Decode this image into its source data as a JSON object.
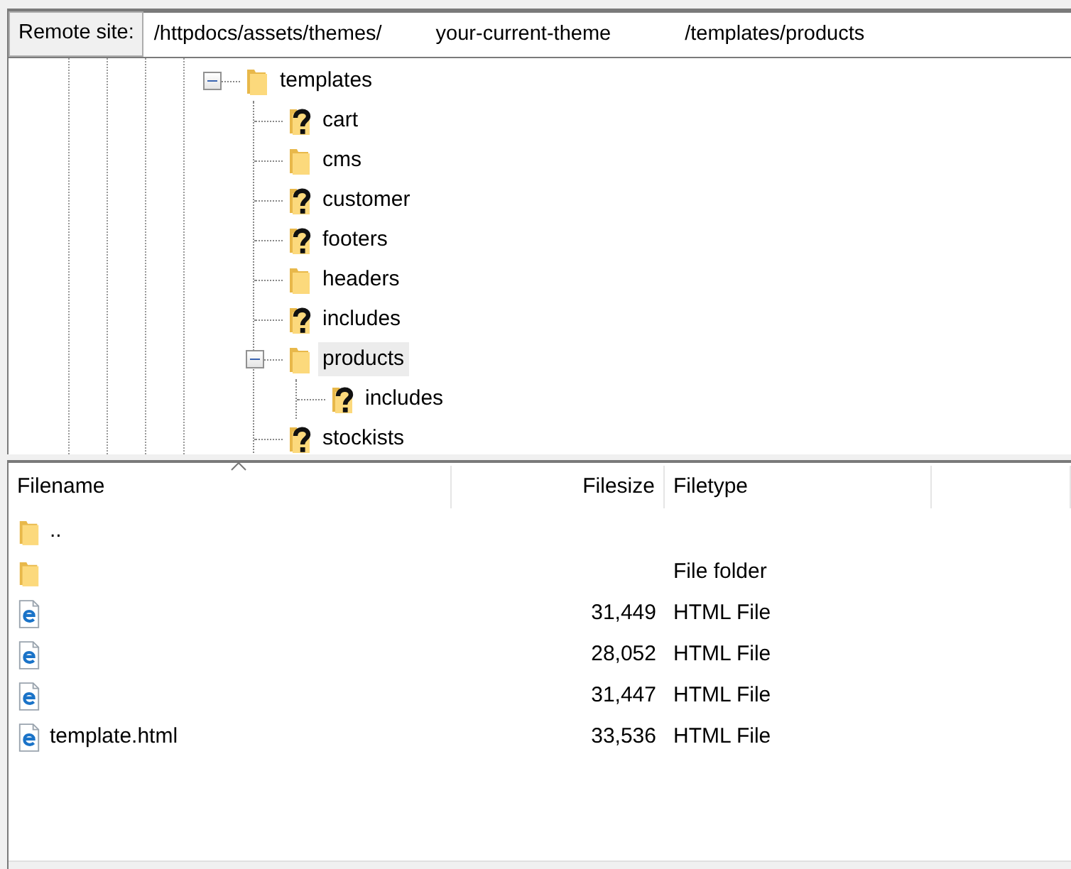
{
  "address_bar": {
    "label": "Remote site:",
    "path_segments": [
      "/httpdocs/assets/themes/",
      "your-current-theme",
      "/templates/products"
    ]
  },
  "tree": [
    {
      "name": "templates",
      "kind": "folder",
      "expanded": true,
      "selected": false,
      "children": [
        {
          "name": "cart",
          "kind": "unknown"
        },
        {
          "name": "cms",
          "kind": "folder"
        },
        {
          "name": "customer",
          "kind": "unknown"
        },
        {
          "name": "footers",
          "kind": "unknown"
        },
        {
          "name": "headers",
          "kind": "folder"
        },
        {
          "name": "includes",
          "kind": "unknown"
        },
        {
          "name": "products",
          "kind": "folder",
          "expanded": true,
          "selected": true,
          "children": [
            {
              "name": "includes",
              "kind": "unknown"
            }
          ]
        },
        {
          "name": "stockists",
          "kind": "unknown"
        }
      ]
    }
  ],
  "file_list": {
    "columns": [
      {
        "label": "Filename",
        "sorted": true
      },
      {
        "label": "Filesize",
        "sorted": false
      },
      {
        "label": "Filetype",
        "sorted": false
      }
    ],
    "rows": [
      {
        "kind": "folder",
        "filename": ".."
      },
      {
        "kind": "folder",
        "filetype": "File folder"
      },
      {
        "kind": "html",
        "filesize": "31,449",
        "filetype": "HTML File"
      },
      {
        "kind": "html",
        "filesize": "28,052",
        "filetype": "HTML File"
      },
      {
        "kind": "html",
        "filesize": "31,447",
        "filetype": "HTML File"
      },
      {
        "kind": "html",
        "filename": "template.html",
        "filesize": "33,536",
        "filetype": "HTML File"
      }
    ]
  }
}
